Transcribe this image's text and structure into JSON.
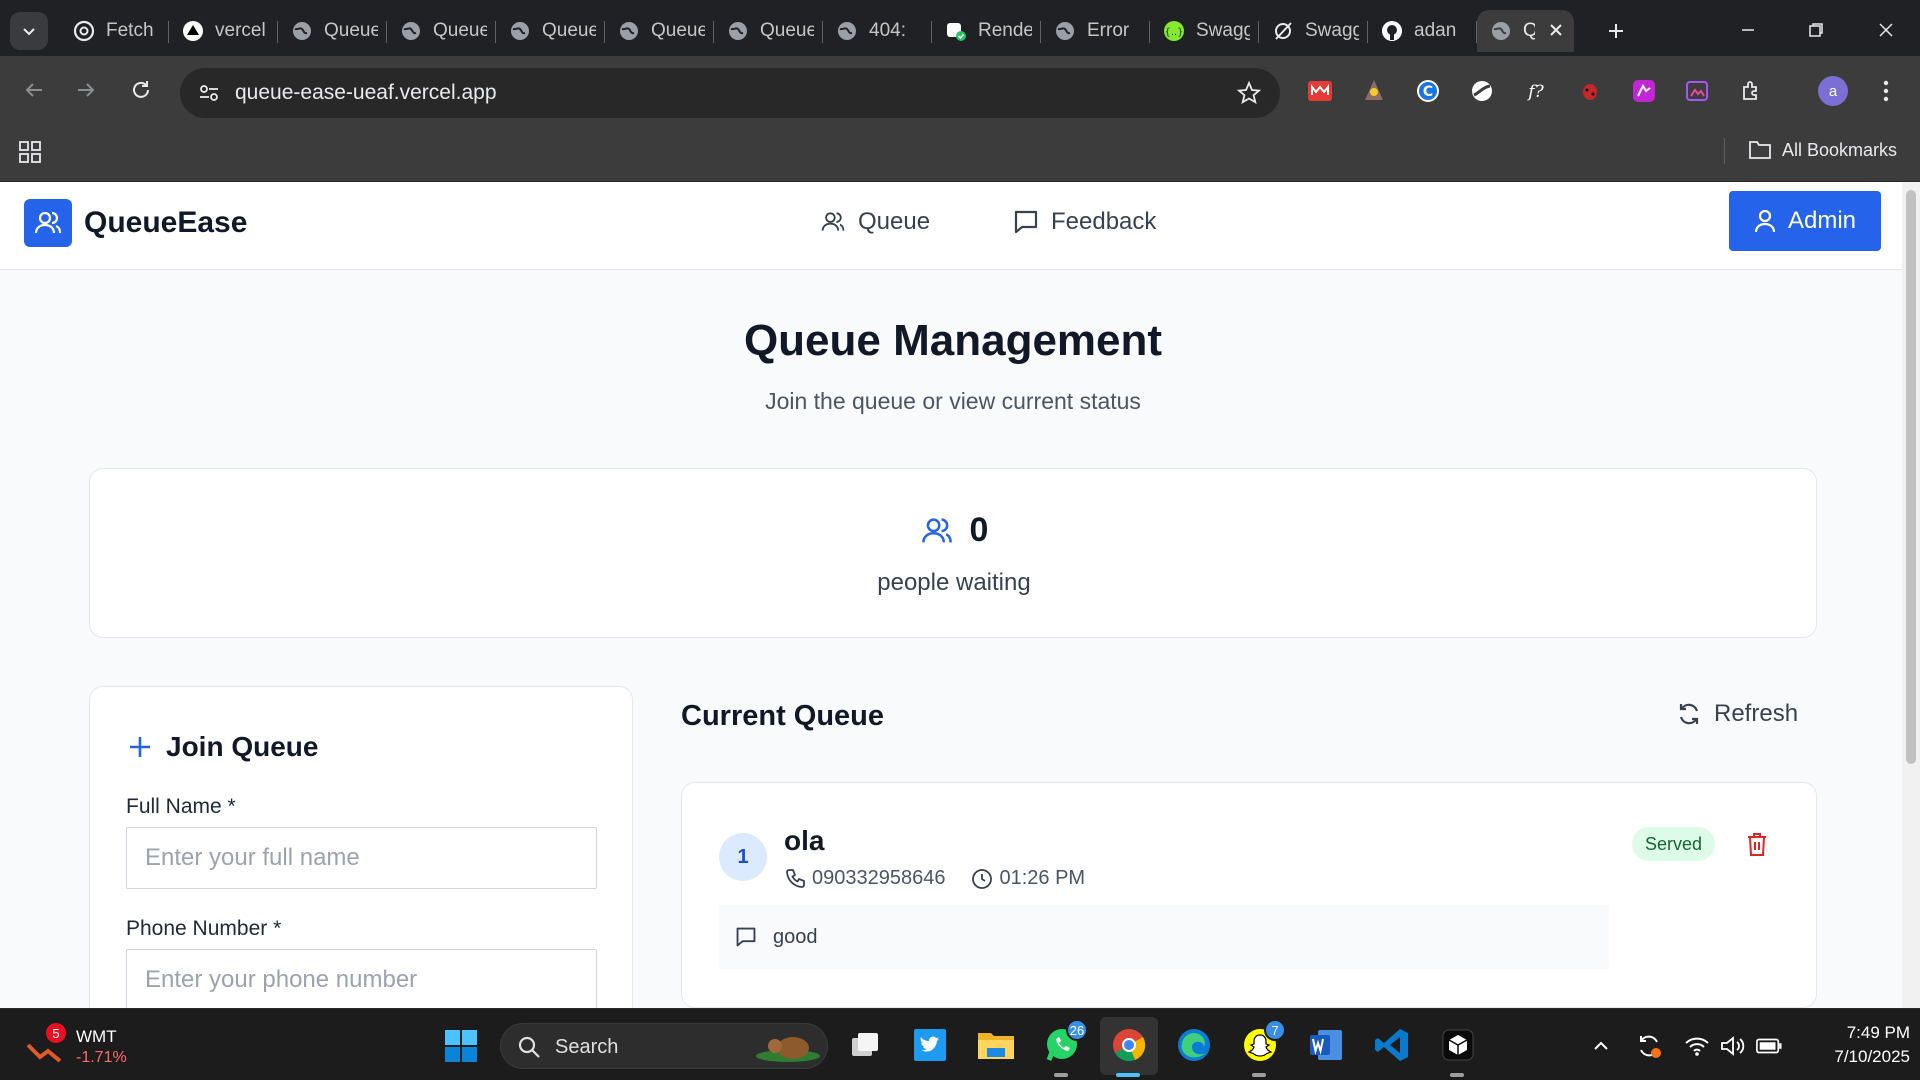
{
  "browser": {
    "tabs": [
      {
        "title": "Fetch",
        "icon": "openai-icon"
      },
      {
        "title": "vercel",
        "icon": "vercel-icon"
      },
      {
        "title": "Queue",
        "icon": "globe-icon"
      },
      {
        "title": "Queue",
        "icon": "globe-icon"
      },
      {
        "title": "Queue",
        "icon": "globe-icon"
      },
      {
        "title": "Queue",
        "icon": "globe-icon"
      },
      {
        "title": "Queue",
        "icon": "globe-icon"
      },
      {
        "title": "404:",
        "icon": "globe-icon"
      },
      {
        "title": "Render",
        "icon": "render-icon"
      },
      {
        "title": "Error",
        "icon": "globe-icon"
      },
      {
        "title": "Swagger",
        "icon": "swagger-icon"
      },
      {
        "title": "Swagger",
        "icon": "swagger-slash-icon"
      },
      {
        "title": "adan",
        "icon": "github-icon"
      },
      {
        "title": "Q",
        "icon": "globe-icon"
      }
    ],
    "url": "queue-ease-ueaf.vercel.app",
    "bookmarks_label": "All Bookmarks",
    "profile_initial": "a"
  },
  "site": {
    "brand": "QueueEase",
    "nav": {
      "queue": "Queue",
      "feedback": "Feedback"
    },
    "admin_label": "Admin"
  },
  "page": {
    "title": "Queue Management",
    "subtitle": "Join the queue or view current status"
  },
  "stats": {
    "waiting_count": "0",
    "waiting_label": "people waiting"
  },
  "join_form": {
    "title": "Join Queue",
    "name_label": "Full Name *",
    "name_placeholder": "Enter your full name",
    "phone_label": "Phone Number *",
    "phone_placeholder": "Enter your phone number"
  },
  "queue": {
    "title": "Current Queue",
    "refresh_label": "Refresh",
    "entries": [
      {
        "position": "1",
        "name": "ola",
        "phone": "090332958646",
        "time": "01:26 PM",
        "status": "Served",
        "feedback": "good"
      }
    ]
  },
  "taskbar": {
    "stock_name": "WMT",
    "stock_change": "-1.71%",
    "stock_badge": "5",
    "search_label": "Search",
    "whatsapp_badge": "26",
    "snapchat_badge": "7",
    "time": "7:49 PM",
    "date": "7/10/2025"
  },
  "colors": {
    "primary": "#2563eb",
    "served_bg": "#dcfce7",
    "served_text": "#166534",
    "delete": "#dc2626"
  }
}
